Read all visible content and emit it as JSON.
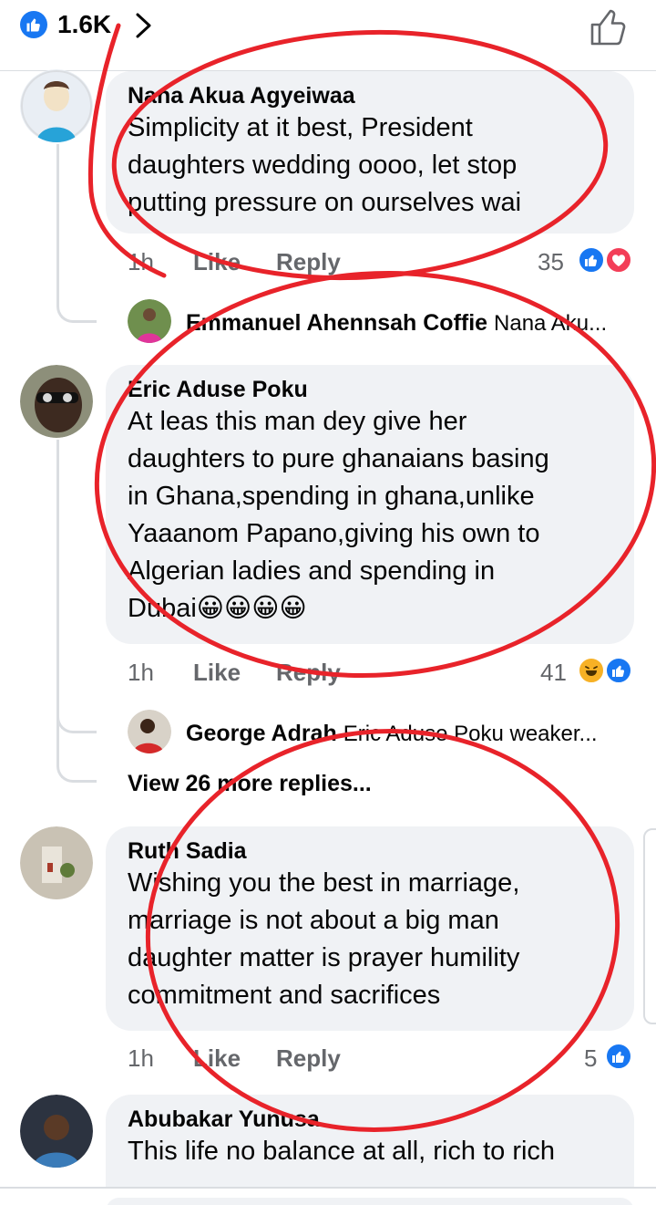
{
  "header": {
    "reaction_count": "1.6K",
    "like_icon": "like-badge-icon",
    "chevron_icon": "chevron-right-icon",
    "thumb_icon": "thumbs-up-outline-icon"
  },
  "comments": [
    {
      "author": "Nana Akua Agyeiwaa",
      "text": "Simplicity at it best, President\ndaughters wedding oooo, let stop\nputting pressure on ourselves wai",
      "time": "1h",
      "like": "Like",
      "reply": "Reply",
      "reaction_count": "35",
      "reactions": [
        "like",
        "love"
      ],
      "reply_preview": {
        "author": "Emmanuel Ahennsah Coffie",
        "text": "Nana Aku..."
      }
    },
    {
      "author": "Eric Aduse Poku",
      "text": "At leas this man dey give her\ndaughters to pure ghanaians basing\nin Ghana,spending in ghana,unlike\nYaaanom Papano,giving his own to\nAlgerian ladies and spending in\nDubai😀😀😀😀",
      "time": "1h",
      "like": "Like",
      "reply": "Reply",
      "reaction_count": "41",
      "reactions": [
        "haha",
        "like"
      ],
      "reply_preview": {
        "author": "George Adrah",
        "text": "Eric Aduse Poku weaker..."
      },
      "view_more": "View 26 more replies..."
    },
    {
      "author": "Ruth Sadia",
      "text": "Wishing you the best in marriage,\nmarriage is not about a big man\ndaughter matter is prayer humility\ncommitment and sacrifices",
      "time": "1h",
      "like": "Like",
      "reply": "Reply",
      "reaction_count": "5",
      "reactions": [
        "like"
      ]
    },
    {
      "author": "Abubakar Yunusa",
      "text": "This life no balance at all, rich to rich"
    }
  ],
  "colors": {
    "facebook_blue": "#1877f2",
    "love_red": "#f33e58",
    "haha_yellow": "#f7b125",
    "bubble_gray": "#f0f2f5",
    "annotation_red": "#e8232a"
  }
}
